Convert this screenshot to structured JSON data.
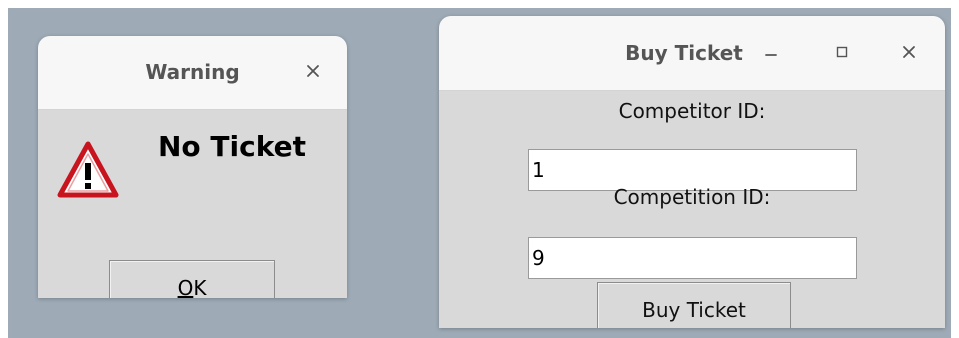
{
  "warning_dialog": {
    "title": "Warning",
    "message": "No Ticket",
    "ok_button": {
      "mnemonic": "O",
      "rest": "K"
    },
    "icon": "warning-triangle-icon"
  },
  "buy_ticket_window": {
    "title": "Buy Ticket",
    "competitor_id": {
      "label": "Competitor ID:",
      "value": "1"
    },
    "competition_id": {
      "label": "Competition ID:",
      "value": "9"
    },
    "buy_button_label": "Buy Ticket",
    "titlebar_icons": [
      "minimize-icon",
      "maximize-icon",
      "close-icon"
    ]
  },
  "colors": {
    "desktop": "#9eabb7",
    "titlebar": "#f7f7f7",
    "window_body": "#d9d9d9",
    "title_text": "#555555",
    "warning_red": "#c8141e"
  }
}
